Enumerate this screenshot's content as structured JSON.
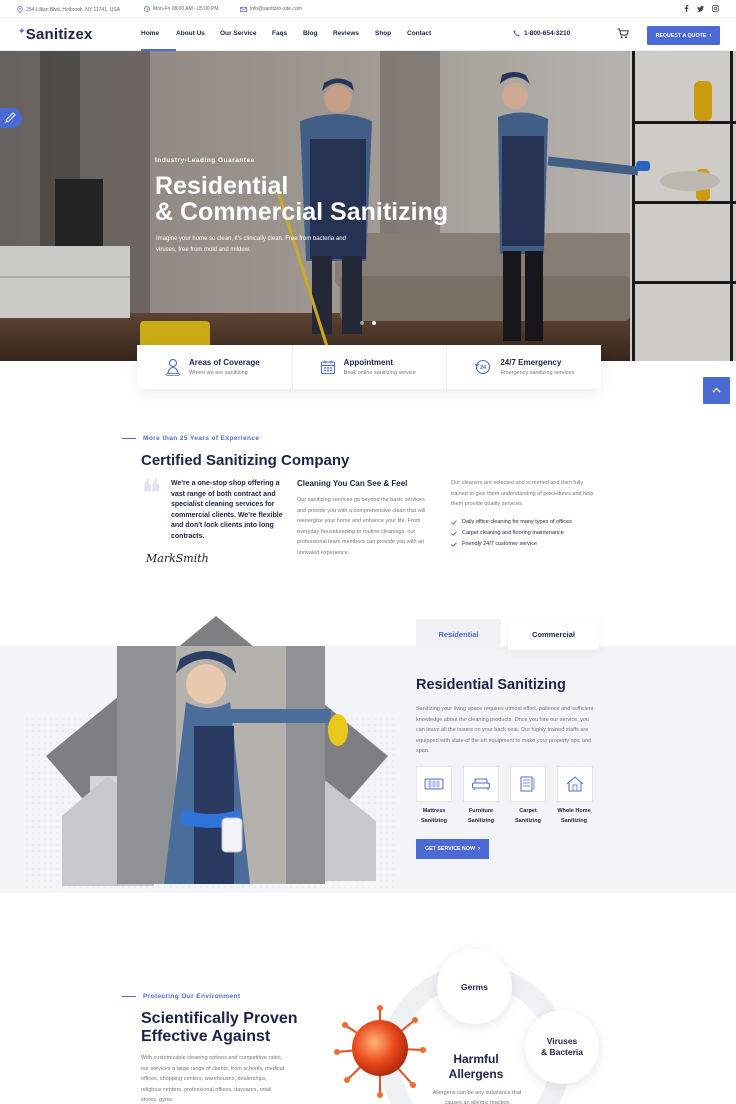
{
  "topbar": {
    "address": "254 Lillian Blvd, Holbrook, NY 11741, USA",
    "hours": "Mon-Fri 08:00 AM - 05:00 PM",
    "email": "info@santizex-site.com",
    "socials": [
      "facebook-icon",
      "twitter-icon",
      "instagram-icon"
    ]
  },
  "header": {
    "logo": "Sanitizex",
    "nav": [
      "Home",
      "About Us",
      "Our Service",
      "Faqs",
      "Blog",
      "Reviews",
      "Shop",
      "Contact"
    ],
    "active_nav": "Home",
    "phone": "1-800-654-3210",
    "quote_button": "REQUEST A QUOTE"
  },
  "hero": {
    "eyebrow": "Industry-Leading Guarantee",
    "title_line1": "Residential",
    "title_line2": "& Commercial Sanitizing",
    "text": "Imagine your home so clean, it's clinically clean. Free from bacteria and viruses, free from mold and mildew.",
    "slides": 2,
    "active_slide": 2
  },
  "features": [
    {
      "title": "Areas of Coverage",
      "text": "Where we are sanitizing",
      "icon": "location-person-icon"
    },
    {
      "title": "Appointment",
      "text": "Book online sanitizing service",
      "icon": "calendar-icon"
    },
    {
      "title": "24/7 Emergency",
      "text": "Emergency sanitizing services",
      "icon": "24h-icon"
    }
  ],
  "about": {
    "subtitle": "More than 25 Years of Experience",
    "title": "Certified Sanitizing Company",
    "quote": "We're a one-stop shop offering a vast range of both contract and specialist cleaning services for commercial clients. We're flexible and don't lock clients into long contracts.",
    "signature": "MarkSmith",
    "col2_title": "Cleaning You Can See & Feel",
    "col2_text": "Our sanitizing services go beyond the basic services and provide you with a comprehensive clean that will reenergize your home and enhance your life. From everyday housekeeping to routine cleanings, our professional team members can provide you with an unrivaled experience.",
    "col3_text": "Our cleaners are selected and screened and then fully trained to give them understanding of procedures and help them provide quality services.",
    "checks": [
      "Daily office cleaning for many types of offices",
      "Carpet cleaning and flooring maintenance",
      "Friendly 24/7 customer service"
    ]
  },
  "services": {
    "tabs": [
      "Residential",
      "Commercial"
    ],
    "active_tab": "Residential",
    "title": "Residential Sanitizing",
    "text": "Sanitizing your living space requires utmost effort, patience and sufficient knowledge about the cleaning products. Once you hire our service, you can leave all the issues on your back seat. Our highly trained staffs are equipped with state-of the art equipment to make your property spic and span.",
    "items": [
      {
        "line1": "Mattress",
        "line2": "Sanitizing",
        "icon": "mattress-icon"
      },
      {
        "line1": "Furniture",
        "line2": "Sanitizing",
        "icon": "sofa-icon"
      },
      {
        "line1": "Carpet",
        "line2": "Sanitizing",
        "icon": "carpet-icon"
      },
      {
        "line1": "Whole Home",
        "line2": "Sanitizing",
        "icon": "house-icon"
      }
    ],
    "button": "GET SERVICE NOW"
  },
  "environment": {
    "subtitle": "Protecting Our Environment",
    "title_line1": "Scientifically Proven",
    "title_line2": "Effective Against",
    "text": "With customizable cleaning options and competitive rates, our services a large range of clients, from schools, medical offices, shopping centers, warehouses, dealerships, religious centers, professional offices, daycares, retail stores, gyms",
    "circles": {
      "germs": "Germs",
      "viruses_line1": "Viruses",
      "viruses_line2": "& Bacteria",
      "allergens_line1": "Harmful",
      "allergens_line2": "Allergens"
    },
    "allergens_text": "Allergens can be any substance that causes an allergic reaction"
  },
  "colors": {
    "accent": "#4c6ad4",
    "navy": "#1b2448",
    "muted": "#777777",
    "grey_bg": "#f3f4f7"
  }
}
